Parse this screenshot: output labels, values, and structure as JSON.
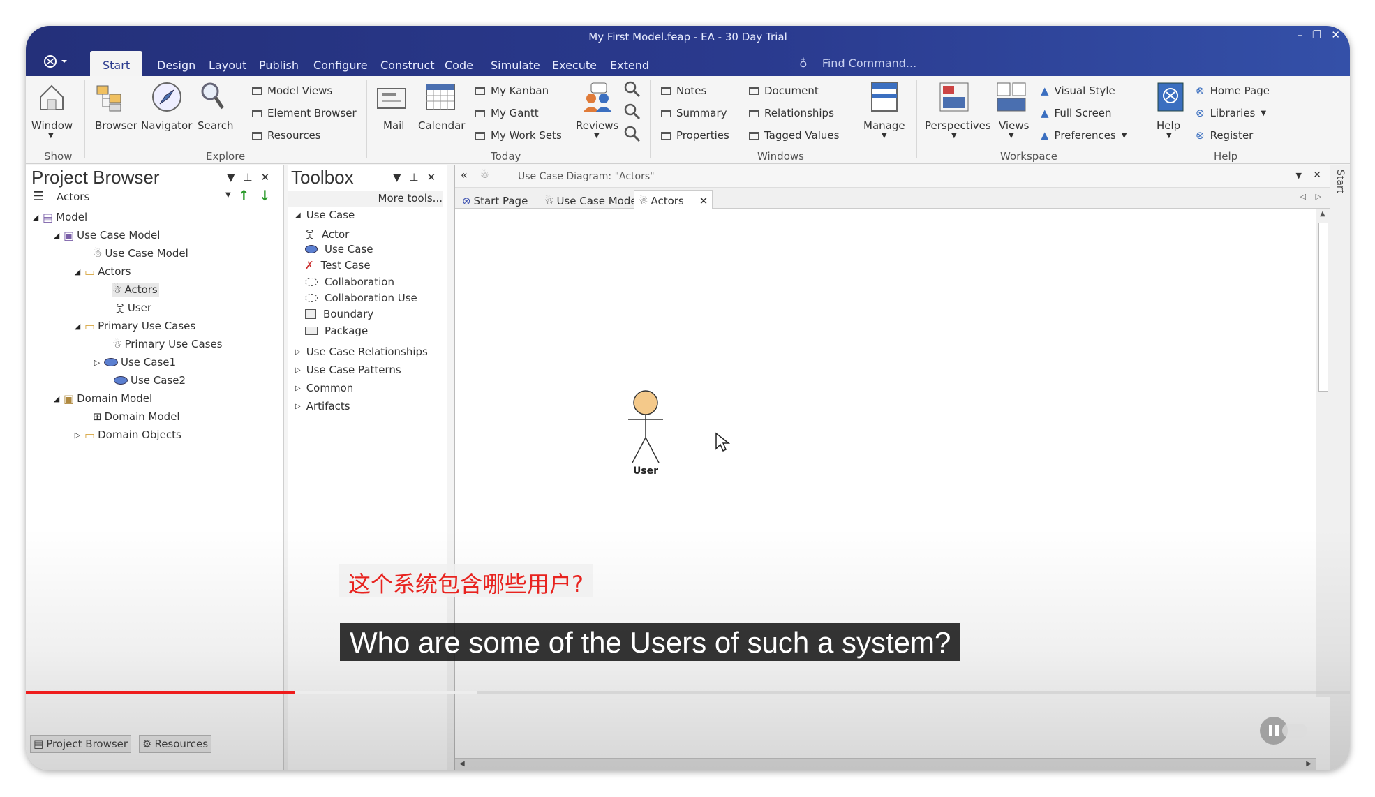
{
  "window": {
    "title": "My First Model.feap - EA - 30 Day Trial"
  },
  "ribbon_tabs": [
    {
      "label": "Start",
      "active": true
    },
    {
      "label": "Design"
    },
    {
      "label": "Layout"
    },
    {
      "label": "Publish"
    },
    {
      "label": "Configure"
    },
    {
      "label": "Construct"
    },
    {
      "label": "Code"
    },
    {
      "label": "Simulate"
    },
    {
      "label": "Execute"
    },
    {
      "label": "Extend"
    }
  ],
  "find_command": {
    "placeholder": "Find Command..."
  },
  "ribbon": {
    "show": {
      "window": "Window",
      "group": "Show"
    },
    "explore": {
      "browser": "Browser",
      "navigator": "Navigator",
      "search": "Search",
      "model_views": "Model Views",
      "element_browser": "Element Browser",
      "resources": "Resources",
      "group": "Explore"
    },
    "today": {
      "mail": "Mail",
      "calendar": "Calendar",
      "my_kanban": "My Kanban",
      "my_gantt": "My Gantt",
      "my_work_sets": "My Work Sets",
      "reviews": "Reviews",
      "group": "Today"
    },
    "windows": {
      "notes": "Notes",
      "summary": "Summary",
      "properties": "Properties",
      "document": "Document",
      "relationships": "Relationships",
      "tagged_values": "Tagged Values",
      "manage": "Manage",
      "group": "Windows"
    },
    "workspace": {
      "perspectives": "Perspectives",
      "views": "Views",
      "visual_style": "Visual Style",
      "full_screen": "Full Screen",
      "preferences": "Preferences",
      "group": "Workspace"
    },
    "help": {
      "help": "Help",
      "home_page": "Home Page",
      "libraries": "Libraries",
      "register": "Register",
      "group": "Help"
    }
  },
  "project_browser": {
    "title": "Project Browser",
    "selector": "Actors",
    "tree": [
      {
        "label": "Model"
      },
      {
        "label": "Use Case Model"
      },
      {
        "label": "Use Case Model"
      },
      {
        "label": "Actors"
      },
      {
        "label": "Actors"
      },
      {
        "label": "User"
      },
      {
        "label": "Primary Use Cases"
      },
      {
        "label": "Primary Use Cases"
      },
      {
        "label": "Use Case1"
      },
      {
        "label": "Use Case2"
      },
      {
        "label": "Domain Model"
      },
      {
        "label": "Domain Model"
      },
      {
        "label": "Domain Objects"
      }
    ],
    "bottom_tabs": [
      "Project Browser",
      "Resources"
    ]
  },
  "toolbox": {
    "title": "Toolbox",
    "more_tools": "More tools...",
    "section": "Use Case",
    "items": [
      "Actor",
      "Use Case",
      "Test Case",
      "Collaboration",
      "Collaboration Use",
      "Boundary",
      "Package"
    ],
    "categories": [
      "Use Case Relationships",
      "Use Case Patterns",
      "Common",
      "Artifacts"
    ]
  },
  "diagram": {
    "header": "Use Case Diagram: \"Actors\"",
    "tabs": [
      "Start Page",
      "Use Case Model",
      "Actors"
    ],
    "actor_label": "User"
  },
  "subtitles": {
    "chinese": "这个系统包含哪些用户?",
    "english": "Who are some of the Users of such a system?"
  },
  "video": {
    "progress_fraction": 0.203,
    "buffered_fraction": 0.341
  },
  "right_strip": {
    "label": "Start"
  },
  "colors": {
    "accent": "#2a3a8e",
    "progress": "#ee1c1c",
    "subtitle_cn": "#e8231f"
  }
}
